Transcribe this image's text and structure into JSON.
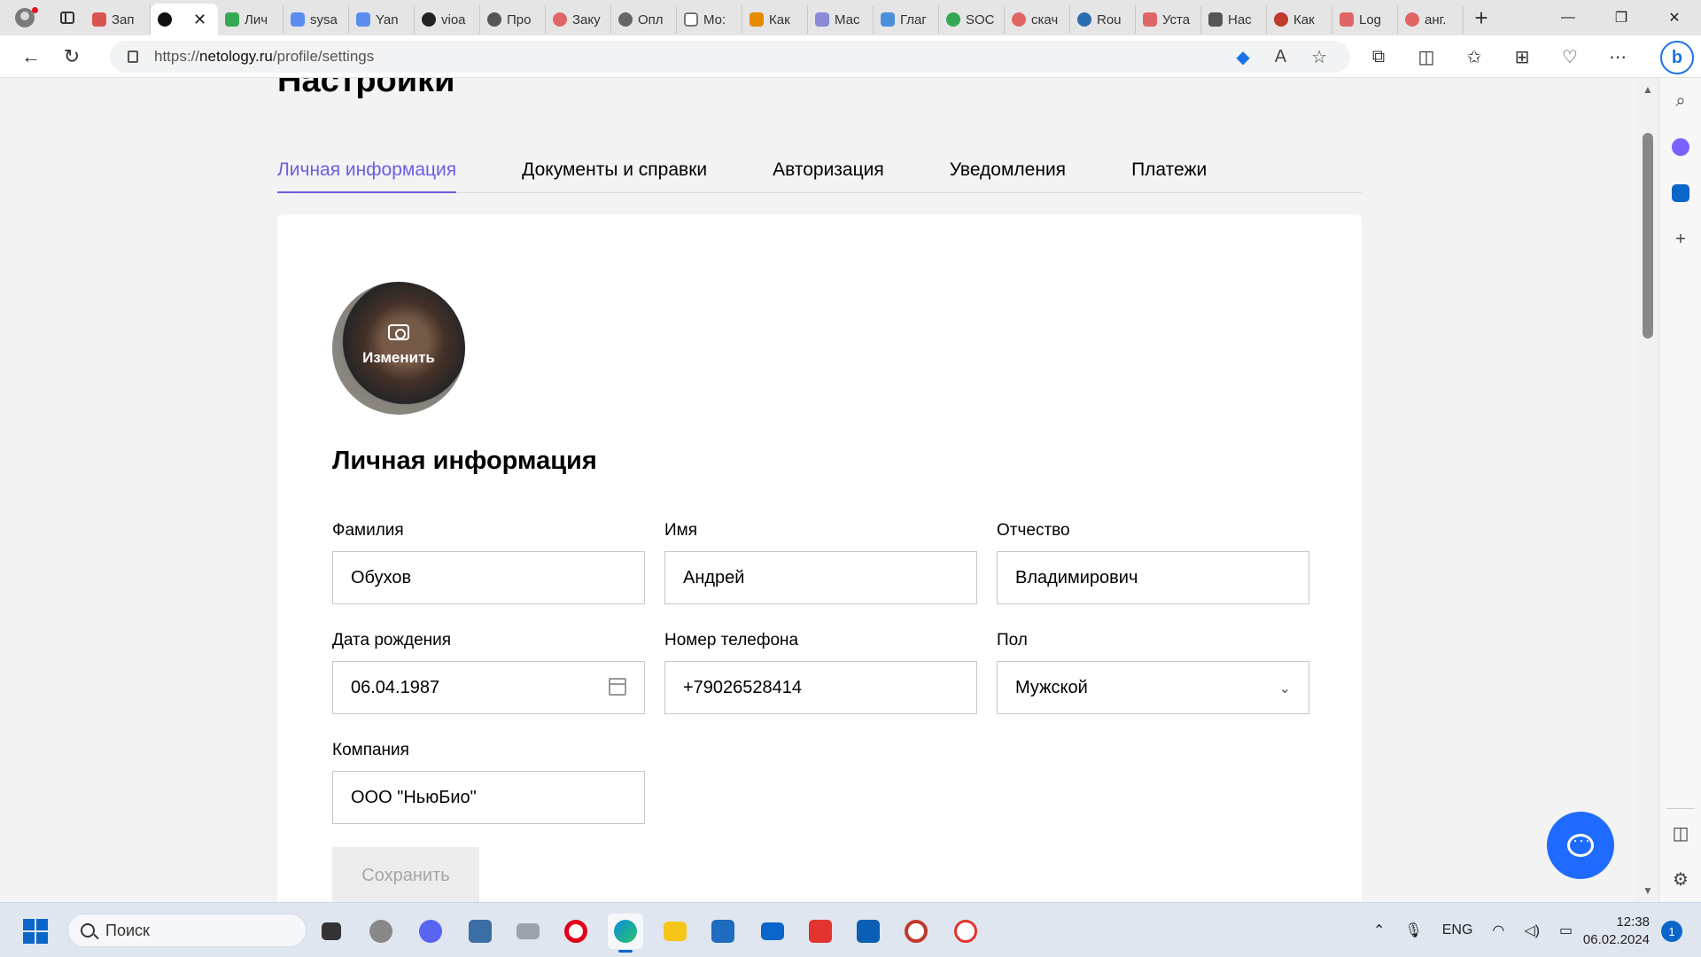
{
  "browser": {
    "tabs": [
      {
        "label": "Зап",
        "color": "#d9534f"
      },
      {
        "label": "",
        "color": "#111111",
        "active": true
      },
      {
        "label": "Лич",
        "color": "#34a853"
      },
      {
        "label": "sysa",
        "color": "#5b8def"
      },
      {
        "label": "Yan",
        "color": "#5b8def"
      },
      {
        "label": "vioa",
        "color": "#222222"
      },
      {
        "label": "Про",
        "color": "#555555"
      },
      {
        "label": "Заку",
        "color": "#e06666"
      },
      {
        "label": "Опл",
        "color": "#666666"
      },
      {
        "label": "Мо:",
        "color": "#777777"
      },
      {
        "label": "Как",
        "color": "#e68a00"
      },
      {
        "label": "Мас",
        "color": "#8a8ad6"
      },
      {
        "label": "Глаг",
        "color": "#4a90d9"
      },
      {
        "label": "SOC",
        "color": "#34a853"
      },
      {
        "label": "скач",
        "color": "#e06666"
      },
      {
        "label": "Rou",
        "color": "#2b6cb0"
      },
      {
        "label": "Уста",
        "color": "#e06666"
      },
      {
        "label": "Нас",
        "color": "#555555"
      },
      {
        "label": "Как",
        "color": "#c0392b"
      },
      {
        "label": "Log",
        "color": "#e06666"
      },
      {
        "label": "анг.",
        "color": "#e06666"
      }
    ],
    "close_glyph": "✕",
    "new_tab_glyph": "+",
    "window": {
      "minimize": "—",
      "maximize": "❐",
      "close": "✕"
    },
    "url_prefix": "https://",
    "url_host": "netology.ru",
    "url_path": "/profile/settings"
  },
  "page": {
    "title": "Настройки",
    "tabs": [
      {
        "label": "Личная информация",
        "active": true
      },
      {
        "label": "Документы и справки"
      },
      {
        "label": "Авторизация"
      },
      {
        "label": "Уведомления"
      },
      {
        "label": "Платежи"
      }
    ],
    "avatar_label": "Изменить",
    "section_title": "Личная информация",
    "fields": {
      "last_name": {
        "label": "Фамилия",
        "value": "Обухов"
      },
      "first_name": {
        "label": "Имя",
        "value": "Андрей"
      },
      "patronymic": {
        "label": "Отчество",
        "value": "Владимирович"
      },
      "birth_date": {
        "label": "Дата рождения",
        "value": "06.04.1987"
      },
      "phone": {
        "label": "Номер телефона",
        "value": "+79026528414"
      },
      "gender": {
        "label": "Пол",
        "value": "Мужской"
      },
      "company": {
        "label": "Компания",
        "value": "ООО \"НьюБио\""
      }
    },
    "save_label": "Сохранить"
  },
  "taskbar": {
    "search_label": "Поиск",
    "language": "ENG",
    "time": "12:38",
    "date": "06.02.2024",
    "notifications": "1"
  },
  "colors": {
    "accent_purple": "#6c5ce7",
    "chat_blue": "#1f6bff",
    "windows_blue": "#0a66c8"
  }
}
